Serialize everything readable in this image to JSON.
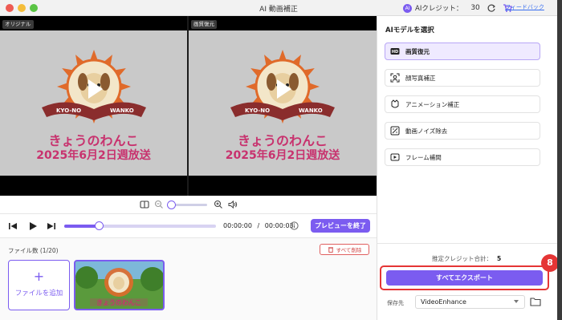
{
  "window": {
    "title": "AI 動画補正",
    "credits_label": "AIクレジット：",
    "credits_value": "30",
    "ai_badge": "AI",
    "feedback": "フィードバック"
  },
  "preview": {
    "left_label": "オリジナル",
    "right_label": "画質復元",
    "logo_left": "KYO-NO",
    "logo_right": "WANKO",
    "hiragana": "きょうのわんこ",
    "date": "2025年6月2日週放送"
  },
  "zoom": {
    "level": 0
  },
  "player": {
    "current_time": "00:00:00",
    "separator": "/",
    "total_time": "00:00:03",
    "progress": 0.23,
    "preview_end_label": "プレビューを終了"
  },
  "files": {
    "count_label": "ファイル数 (1/20)",
    "delete_all_label": "すべて削除",
    "add_plus": "+",
    "add_label": "ファイルを追加"
  },
  "panel": {
    "title": "AIモデルを選択",
    "models": [
      {
        "label": "画質復元",
        "icon": "hd-icon",
        "active": true
      },
      {
        "label": "顔写真補正",
        "icon": "face-scan-icon",
        "active": false
      },
      {
        "label": "アニメーション補正",
        "icon": "animation-icon",
        "active": false
      },
      {
        "label": "動画ノイズ除去",
        "icon": "denoise-icon",
        "active": false
      },
      {
        "label": "フレーム補間",
        "icon": "frame-interpolation-icon",
        "active": false
      }
    ],
    "estimate_label": "推定クレジット合計：",
    "estimate_value": "5",
    "export_label": "すべてエクスポート",
    "step_badge": "8",
    "save_label": "保存先",
    "save_value": "VideoEnhance"
  },
  "colors": {
    "accent": "#7b5cf0",
    "highlight": "#e53535",
    "title_pink": "#c8326e"
  }
}
